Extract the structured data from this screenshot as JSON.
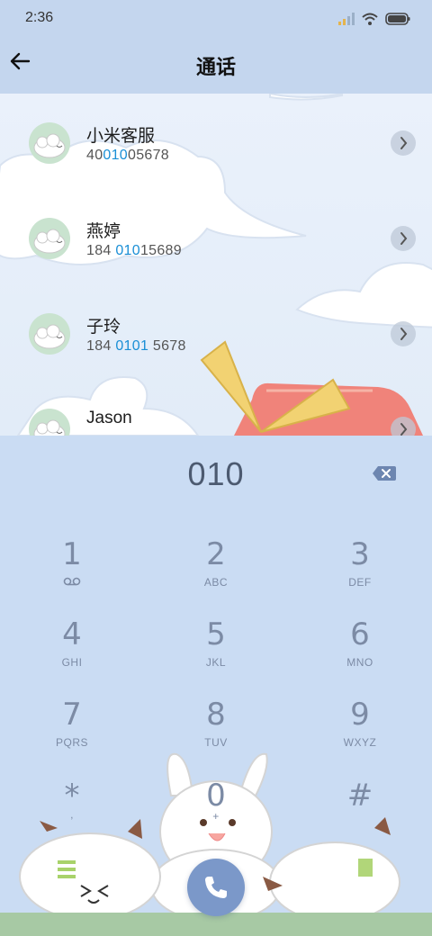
{
  "status_bar": {
    "time": "2:36",
    "icons": [
      "signal-icon",
      "wifi-icon",
      "battery-icon"
    ]
  },
  "header": {
    "back_icon": "arrow-left-icon",
    "title": "通话"
  },
  "contacts": [
    {
      "name": "小米客服",
      "number_pre": "40",
      "number_hl": "010",
      "number_post": "05678"
    },
    {
      "name": "燕婷",
      "number_pre": "184 ",
      "number_hl": "010",
      "number_post": "15689"
    },
    {
      "name": "子玲",
      "number_pre": "184 ",
      "number_hl": "0101",
      "number_post": " 5678"
    },
    {
      "name": "Jason",
      "number_pre": "",
      "number_hl": "",
      "number_post": ""
    }
  ],
  "dialer": {
    "input": "010",
    "keys": [
      {
        "num": "1",
        "sub": ""
      },
      {
        "num": "2",
        "sub": "ABC"
      },
      {
        "num": "3",
        "sub": "DEF"
      },
      {
        "num": "4",
        "sub": "GHI"
      },
      {
        "num": "5",
        "sub": "JKL"
      },
      {
        "num": "6",
        "sub": "MNO"
      },
      {
        "num": "7",
        "sub": "PQRS"
      },
      {
        "num": "8",
        "sub": "TUV"
      },
      {
        "num": "9",
        "sub": "WXYZ"
      },
      {
        "num": "*",
        "sub": ","
      },
      {
        "num": "0",
        "sub": "+"
      },
      {
        "num": "#",
        "sub": ""
      }
    ],
    "call_icon": "phone-icon",
    "backspace_icon": "backspace-icon"
  },
  "colors": {
    "header_bg": "#c4d6ee",
    "highlight": "#1a8fd6",
    "key_text": "#7c8ba5",
    "call_button": "#7b98c9"
  }
}
